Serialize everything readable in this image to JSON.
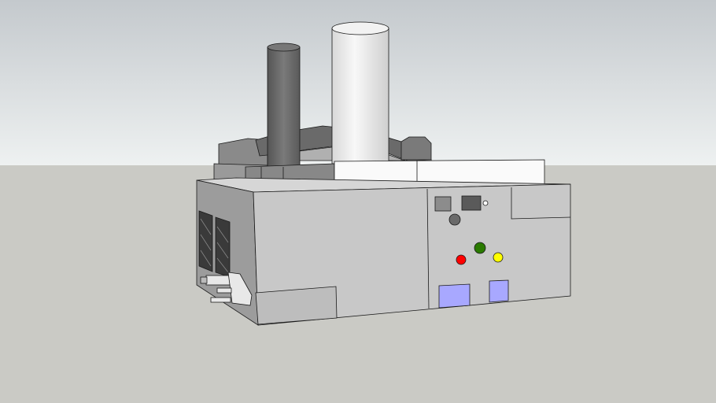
{
  "scene": {
    "colors": {
      "sky_top": "#c4c9cd",
      "sky_horizon": "#eef1f1",
      "ground": "#cacac5",
      "wall_front": "#c8c8c8",
      "wall_side": "#9c9c9c",
      "roof": "#d6d6d6",
      "chimney_dark": "#6e6e6e",
      "chimney_white": "#eeeeee",
      "button_red": "#ff0000",
      "button_green": "#2a7a00",
      "button_yellow": "#ffff00",
      "door_blue": "#a8a8ff",
      "outline": "#1a1a1a"
    }
  }
}
